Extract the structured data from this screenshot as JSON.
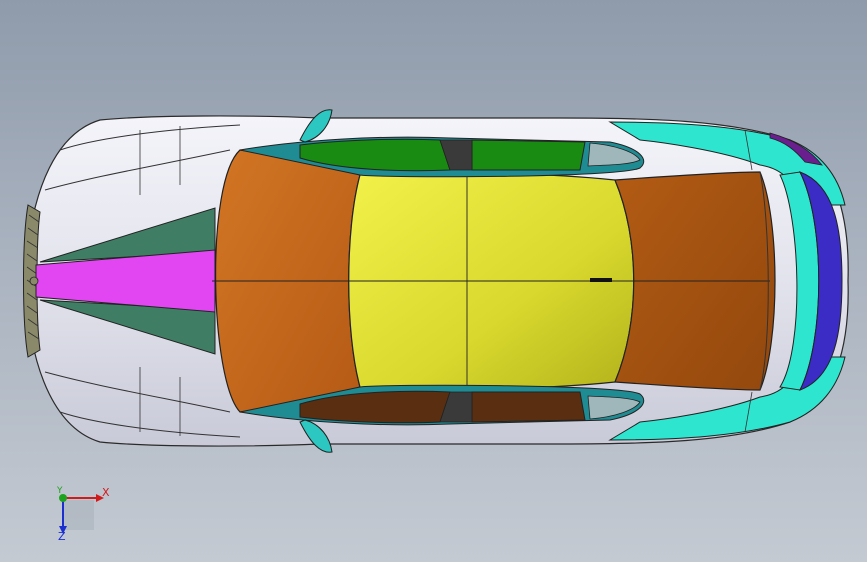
{
  "app": {
    "view": "graphics-viewport",
    "background_top": "#8f9bab",
    "background_bottom": "#c4cad2"
  },
  "model": {
    "icon": "car-body-top-view",
    "colors": {
      "body": "#e4e5ee",
      "hood_stripe": "#e246f2",
      "hood_green": "#3f7d64",
      "windshield": "#c8681c",
      "roof": "#e1e239",
      "rear_window": "#a85312",
      "side_glass": "#1a8b12",
      "side_glass_dark": "#5a2e10",
      "trim": "#1f8c94",
      "rear_cyan": "#2ee6cf",
      "rear_blue": "#3b2cc6",
      "mirror": "#2bc7c0"
    }
  },
  "triad": {
    "x_label": "X",
    "y_label": "Y",
    "z_label": "Z",
    "x_color": "#d11b1b",
    "y_color": "#1da31d",
    "z_color": "#1b2fd1"
  }
}
